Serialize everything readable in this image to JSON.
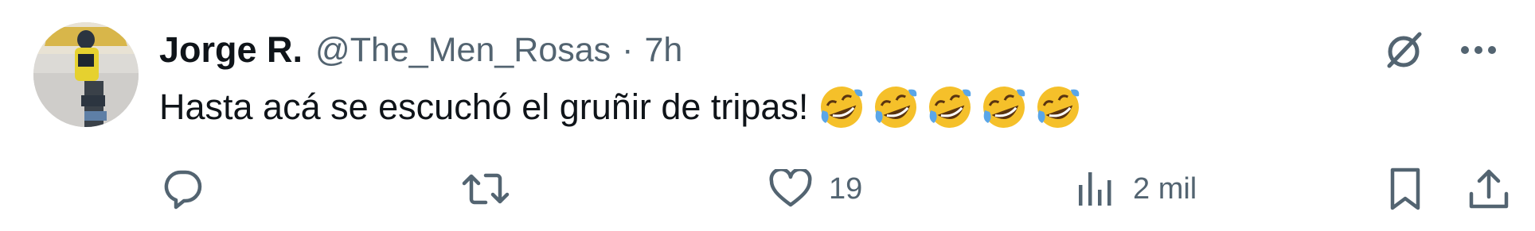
{
  "tweet": {
    "author_name": "Jorge R.",
    "author_handle": "@The_Men_Rosas",
    "separator": "·",
    "time": "7h",
    "text": "Hasta acá se escuchó el gruñir de tripas!",
    "emojis": [
      "rolling-on-floor-laughing",
      "rolling-on-floor-laughing",
      "rolling-on-floor-laughing",
      "rolling-on-floor-laughing",
      "rolling-on-floor-laughing"
    ]
  },
  "actions": {
    "reply": {
      "icon": "reply-icon",
      "count": ""
    },
    "retweet": {
      "icon": "retweet-icon",
      "count": ""
    },
    "like": {
      "icon": "heart-icon",
      "count": "19"
    },
    "views": {
      "icon": "views-icon",
      "count": "2 mil"
    },
    "bookmark": {
      "icon": "bookmark-icon"
    },
    "share": {
      "icon": "share-icon"
    }
  },
  "colors": {
    "text": "#0f1419",
    "secondary": "#536471",
    "background": "#ffffff"
  }
}
